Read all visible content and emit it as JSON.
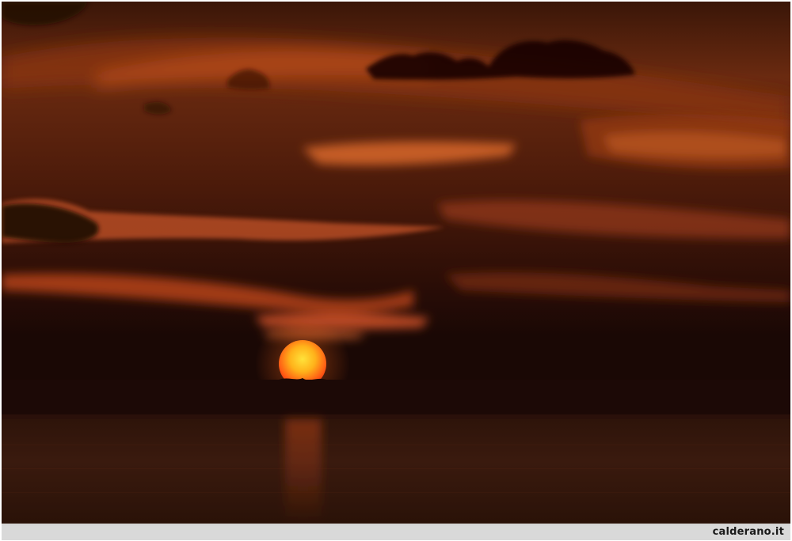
{
  "photo": {
    "subject": "sunset-over-sea",
    "colors": {
      "sky_top": "#3a1608",
      "sky_mid": "#6a2a10",
      "sky_low": "#2a0f06",
      "horizon": "#1a0805",
      "sea": "#3a1a0e",
      "cloud_glow": "#e0642a",
      "cloud_bright": "#f08a3a",
      "cloud_dark": "#140605",
      "sun_core": "#ffd21a",
      "sun_edge": "#ff4a14"
    }
  },
  "caption": {
    "text": "calderano.it"
  }
}
